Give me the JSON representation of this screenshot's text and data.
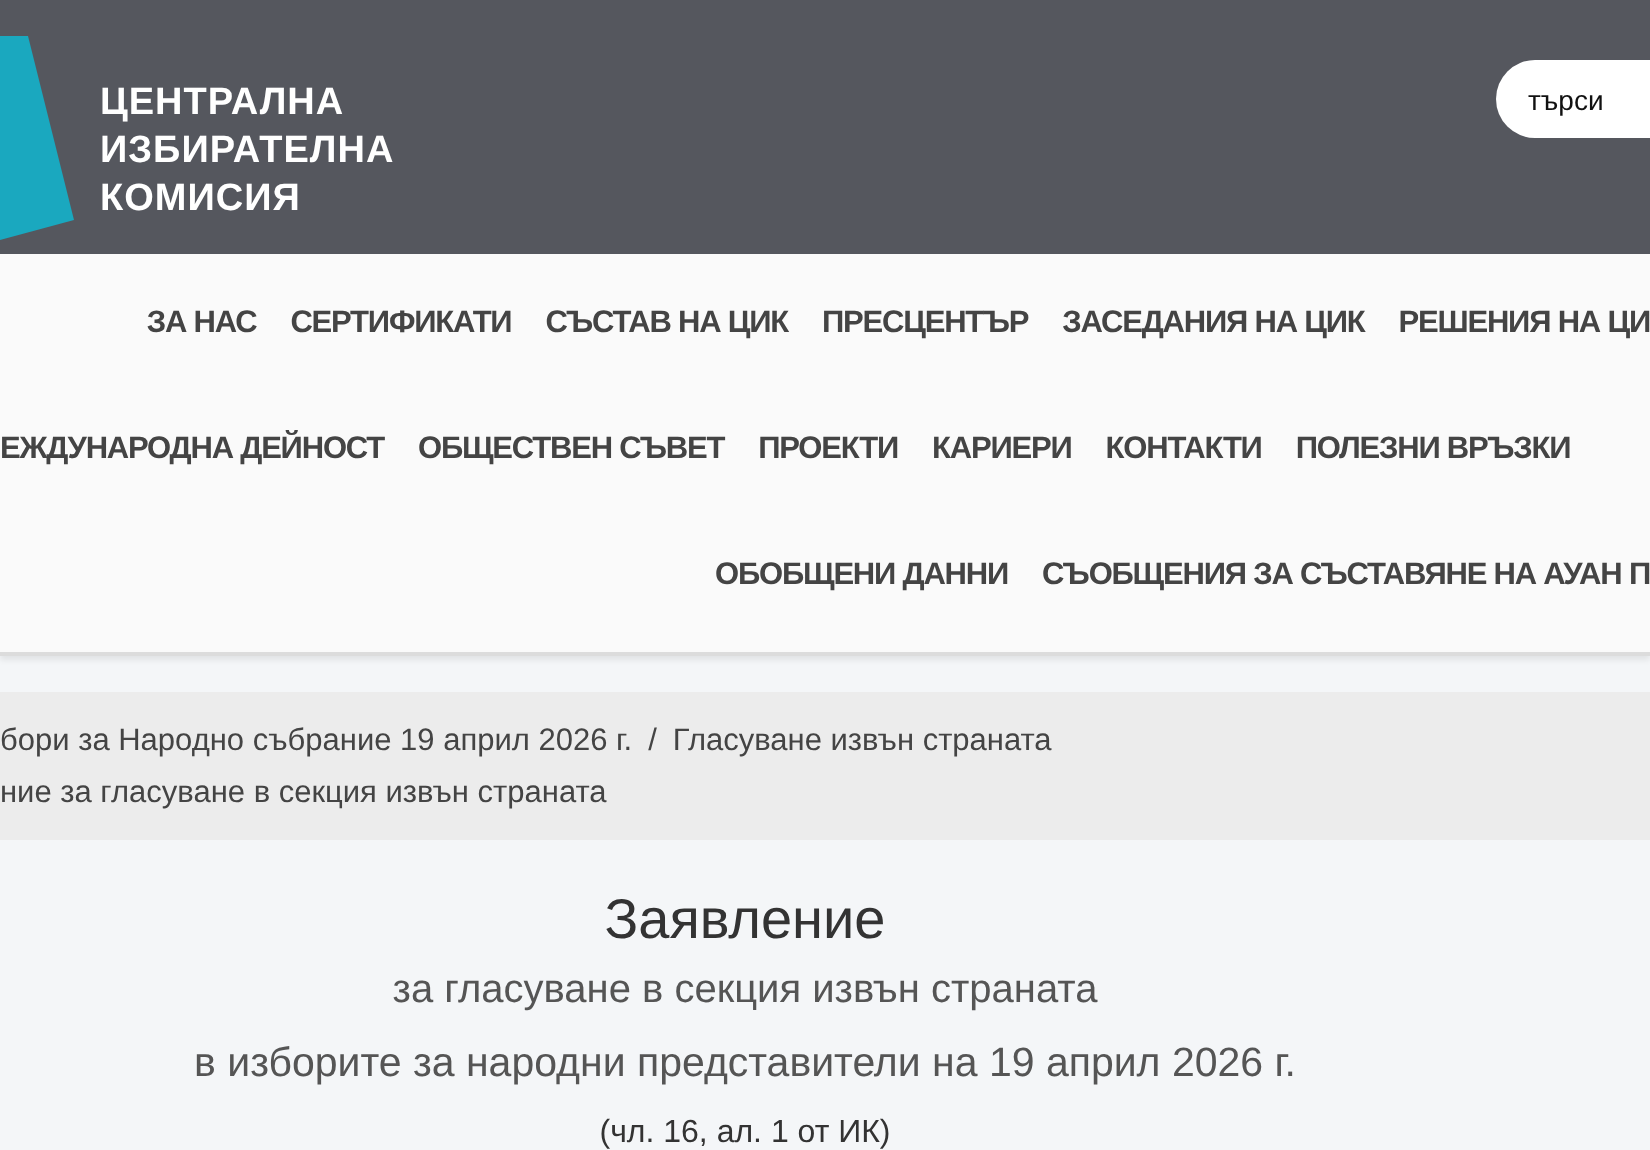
{
  "header": {
    "logo_lines": [
      "ЦЕНТРАЛНА",
      "ИЗБИРАТЕЛНА",
      "КОМИСИЯ"
    ],
    "search": {
      "placeholder": "търси"
    }
  },
  "nav_rows": [
    {
      "items": [
        "ЗА НАС",
        "СЕРТИФИКАТИ",
        "СЪСТАВ НА ЦИК",
        "ПРЕСЦЕНТЪР",
        "ЗАСЕДАНИЯ НА ЦИК",
        "РЕШЕНИЯ НА ЦИ"
      ]
    },
    {
      "items": [
        "ЕЖДУНАРОДНА ДЕЙНОСТ",
        "ОБЩЕСТВЕН СЪВЕТ",
        "ПРОЕКТИ",
        "КАРИЕРИ",
        "КОНТАКТИ",
        "ПОЛЕЗНИ ВРЪЗКИ"
      ]
    },
    {
      "items": [
        "ОБОБЩЕНИ ДАННИ",
        "СЪОБЩЕНИЯ ЗА СЪСТАВЯНЕ НА АУАН П"
      ]
    }
  ],
  "breadcrumb": {
    "separator": "/",
    "lines": [
      [
        "бори за Народно събрание 19 април 2026 г.",
        "Гласуване извън страната"
      ],
      [
        "ние за гласуване в секция извън страната"
      ]
    ]
  },
  "document": {
    "title": "Заявление",
    "subtitle": "за гласуване в секция извън страната",
    "line": "в изборите за народни представители на 19 април 2026 г.",
    "reference": "(чл. 16, ал. 1 от ИК)"
  }
}
